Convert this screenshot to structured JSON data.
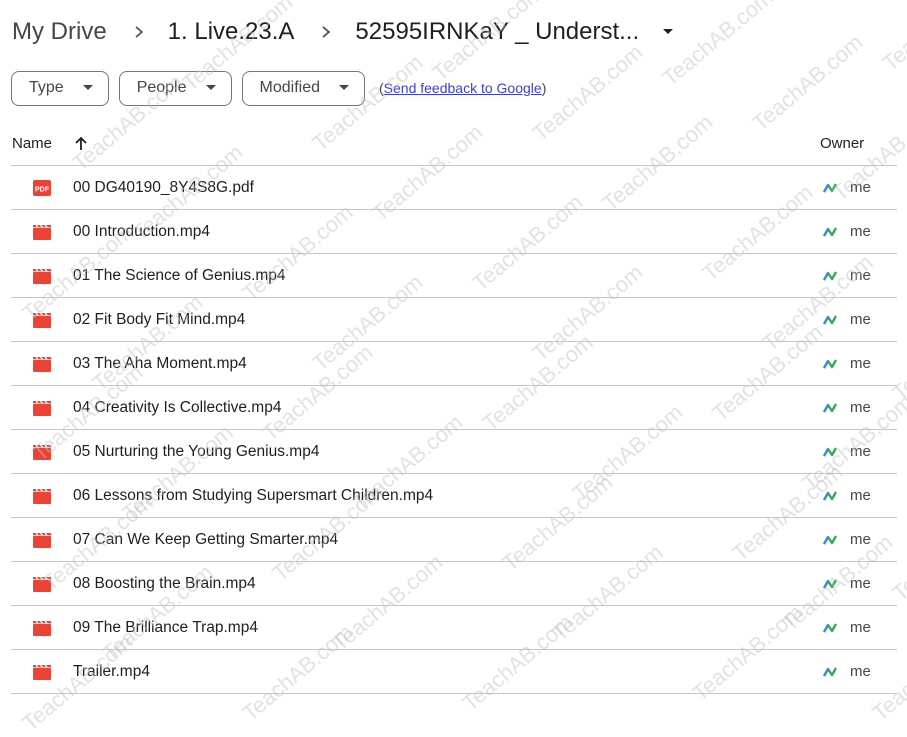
{
  "breadcrumb": {
    "items": [
      "My Drive",
      "1. Live.23.A",
      "52595IRNKaY _ Underst..."
    ],
    "separator_icon": "chevron-right-icon",
    "dropdown_icon": "caret-down-icon"
  },
  "filters": {
    "chips": [
      {
        "label": "Type"
      },
      {
        "label": "People"
      },
      {
        "label": "Modified"
      }
    ],
    "feedback_prefix": "(",
    "feedback_link": "Send feedback to Google",
    "feedback_suffix": ")"
  },
  "table": {
    "columns": {
      "name": "Name",
      "owner": "Owner"
    },
    "sort_icon": "arrow-up-icon",
    "rows": [
      {
        "name": "00 DG40190_8Y4S8G.pdf",
        "type": "pdf",
        "owner": "me"
      },
      {
        "name": "00 Introduction.mp4",
        "type": "video",
        "owner": "me"
      },
      {
        "name": "01 The Science of Genius.mp4",
        "type": "video",
        "owner": "me"
      },
      {
        "name": "02 Fit Body Fit Mind.mp4",
        "type": "video",
        "owner": "me"
      },
      {
        "name": "03 The Aha Moment.mp4",
        "type": "video",
        "owner": "me"
      },
      {
        "name": "04 Creativity Is Collective.mp4",
        "type": "video",
        "owner": "me"
      },
      {
        "name": "05 Nurturing the Young Genius.mp4",
        "type": "video",
        "owner": "me"
      },
      {
        "name": "06 Lessons from Studying Supersmart Children.mp4",
        "type": "video",
        "owner": "me"
      },
      {
        "name": "07 Can We Keep Getting Smarter.mp4",
        "type": "video",
        "owner": "me"
      },
      {
        "name": "08 Boosting the Brain.mp4",
        "type": "video",
        "owner": "me"
      },
      {
        "name": "09 The Brilliance Trap.mp4",
        "type": "video",
        "owner": "me"
      },
      {
        "name": "Trailer.mp4",
        "type": "video",
        "owner": "me"
      }
    ]
  },
  "icons": {
    "pdf_label": "PDF"
  },
  "colors": {
    "file_icon_red": "#ea4335",
    "link_blue": "#3b3fd8",
    "divider": "#c7c7c7",
    "avatar_green": "#34a853",
    "avatar_blue": "#4285f4"
  },
  "watermark": {
    "text": "TeachAB.com"
  }
}
